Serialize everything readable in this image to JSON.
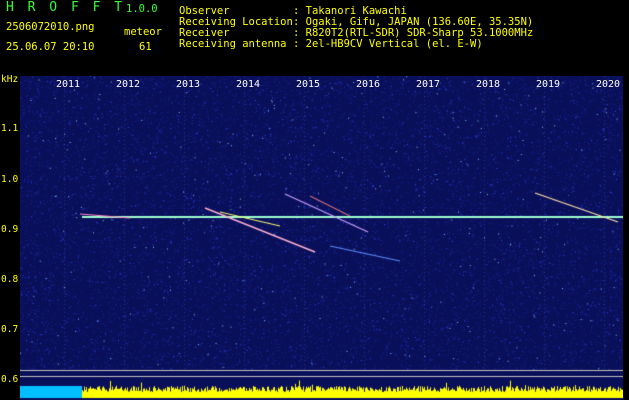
{
  "header": {
    "logo": "H R O F F T",
    "version": "1.0.0",
    "filename": "2506072010.png",
    "meteor_label": "meteor",
    "datetime": "25.06.07 20:10",
    "meteor_count": "61",
    "info_labels": [
      "Observer",
      "Receiving Location",
      "Receiver",
      "Receiving antenna"
    ],
    "info_values": [
      ": Takanori Kawachi",
      ": Ogaki, Gifu, JAPAN (136.60E, 35.35N)",
      ": R820T2(RTL-SDR) SDR-Sharp 53.1000MHz",
      ": 2el-HB9CV Vertical (el. E-W)"
    ]
  },
  "plot": {
    "y_unit": "kHz",
    "y_ticks": [
      "1.1",
      "1.0",
      "0.9",
      "0.8",
      "0.7",
      "0.6"
    ],
    "x_ticks": [
      "2011",
      "2012",
      "2013",
      "2014",
      "2015",
      "2016",
      "2017",
      "2018",
      "2019",
      "2020"
    ],
    "colors": {
      "background": "#0a0f5a",
      "carrier": "#9cffd0",
      "histogram": "#ffff00"
    }
  }
}
